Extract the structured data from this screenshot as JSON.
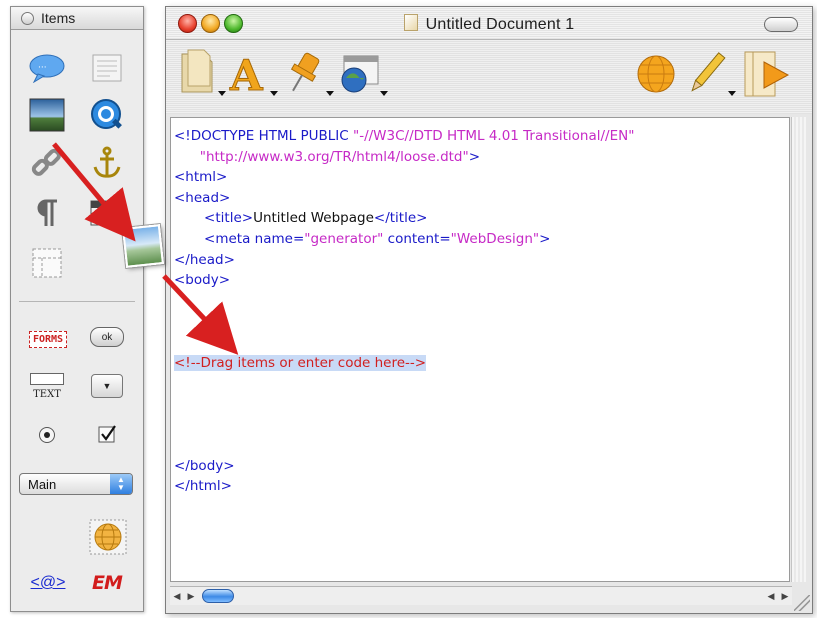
{
  "palette": {
    "title": "Items",
    "items": [
      {
        "name": "speech-bubble-icon"
      },
      {
        "name": "text-block-icon"
      },
      {
        "name": "image-icon"
      },
      {
        "name": "quicktime-icon"
      },
      {
        "name": "link-icon"
      },
      {
        "name": "anchor-icon"
      },
      {
        "name": "paragraph-icon"
      },
      {
        "name": "table-icon"
      },
      {
        "name": "layer-icon"
      }
    ],
    "forms_label": "FORMS",
    "ok_label": "ok",
    "text_field_label": "TEXT",
    "popup_value": "Main",
    "email_label": "<@>",
    "em_label": "EM"
  },
  "window": {
    "title": "Untitled Document 1"
  },
  "toolbar": {
    "items": [
      "document-icon",
      "font-icon",
      "pushpin-icon",
      "site-icon",
      "preview-globe-icon",
      "pencil-icon",
      "preview-play-icon"
    ]
  },
  "editor": {
    "lines": [
      {
        "parts": [
          {
            "t": "<!DOCTYPE HTML PUBLIC ",
            "c": "tag"
          },
          {
            "t": "\"-//W3C//DTD HTML 4.01 Transitional//EN\"",
            "c": "str"
          }
        ]
      },
      {
        "parts": [
          {
            "t": "      \"http://www.w3.org/TR/html4/loose.dtd\"",
            "c": "str"
          },
          {
            "t": ">",
            "c": "tag"
          }
        ]
      },
      {
        "parts": [
          {
            "t": "<html>",
            "c": "tag"
          }
        ]
      },
      {
        "parts": [
          {
            "t": "<head>",
            "c": "tag"
          }
        ]
      },
      {
        "parts": [
          {
            "t": "       <title>",
            "c": "tag"
          },
          {
            "t": "Untitled Webpage",
            "c": "txt"
          },
          {
            "t": "</title>",
            "c": "tag"
          }
        ]
      },
      {
        "parts": [
          {
            "t": "       <meta name=",
            "c": "tag"
          },
          {
            "t": "\"generator\"",
            "c": "str"
          },
          {
            "t": " content=",
            "c": "tag"
          },
          {
            "t": "\"WebDesign\"",
            "c": "str"
          },
          {
            "t": ">",
            "c": "tag"
          }
        ]
      },
      {
        "parts": [
          {
            "t": "</head>",
            "c": "tag"
          }
        ]
      },
      {
        "parts": [
          {
            "t": "<body>",
            "c": "tag"
          }
        ]
      },
      {
        "parts": []
      },
      {
        "parts": []
      },
      {
        "parts": []
      },
      {
        "parts": [
          {
            "t": "<!--Drag items or enter code here-->",
            "c": "comment"
          }
        ]
      },
      {
        "parts": []
      },
      {
        "parts": []
      },
      {
        "parts": []
      },
      {
        "parts": []
      },
      {
        "parts": [
          {
            "t": "</body>",
            "c": "tag"
          }
        ]
      },
      {
        "parts": [
          {
            "t": "</html>",
            "c": "tag"
          }
        ]
      }
    ]
  },
  "colors": {
    "tag": "#1a1ac8",
    "string": "#c62ac6",
    "comment": "#d11f1f",
    "selection": "#c8daf6",
    "arrow": "#d82020"
  }
}
